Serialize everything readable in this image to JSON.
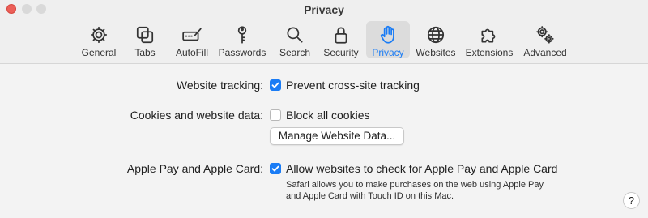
{
  "window": {
    "title": "Privacy"
  },
  "toolbar": {
    "tabs": [
      {
        "label": "General",
        "icon": "gear-icon"
      },
      {
        "label": "Tabs",
        "icon": "tabs-icon"
      },
      {
        "label": "AutoFill",
        "icon": "autofill-icon"
      },
      {
        "label": "Passwords",
        "icon": "key-icon"
      },
      {
        "label": "Search",
        "icon": "search-icon"
      },
      {
        "label": "Security",
        "icon": "lock-icon"
      },
      {
        "label": "Privacy",
        "icon": "hand-icon",
        "selected": true
      },
      {
        "label": "Websites",
        "icon": "globe-icon"
      },
      {
        "label": "Extensions",
        "icon": "puzzle-icon"
      },
      {
        "label": "Advanced",
        "icon": "gears-icon"
      }
    ]
  },
  "settings": {
    "tracking": {
      "label": "Website tracking:",
      "option": "Prevent cross-site tracking",
      "checked": true
    },
    "cookies": {
      "label": "Cookies and website data:",
      "option": "Block all cookies",
      "checked": false,
      "button": "Manage Website Data..."
    },
    "applepay": {
      "label": "Apple Pay and Apple Card:",
      "option": "Allow websites to check for Apple Pay and Apple Card",
      "checked": true,
      "description_line1": "Safari allows you to make purchases on the web using Apple Pay",
      "description_line2": "and Apple Card with Touch ID on this Mac."
    }
  },
  "help": {
    "label": "?"
  },
  "colors": {
    "accent": "#1a7cf5",
    "close": "#ec5f58",
    "selected_tab_bg": "#dcdcdc"
  }
}
